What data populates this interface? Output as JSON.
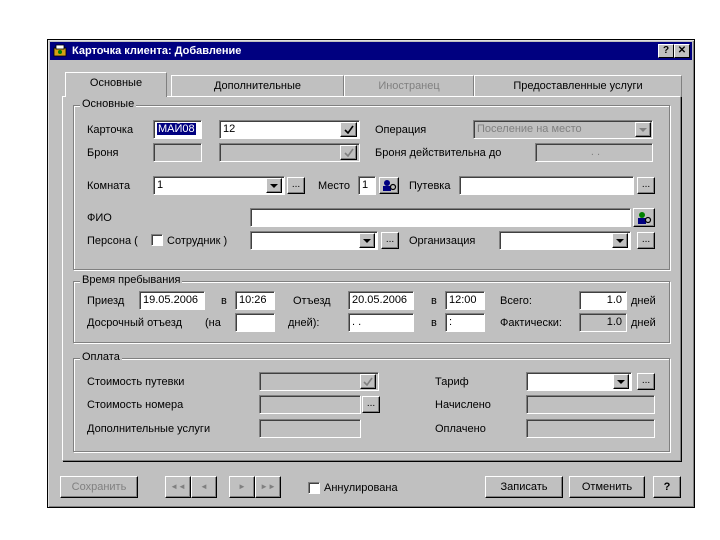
{
  "window": {
    "title": "Карточка клиента: Добавление",
    "help_btn": "?",
    "close_btn": "✕"
  },
  "tabs": [
    {
      "label": "Основные"
    },
    {
      "label": "Дополнительные"
    },
    {
      "label": "Иностранец"
    },
    {
      "label": "Предоставленные услуги"
    }
  ],
  "basic": {
    "legend": "Основные",
    "card_label": "Карточка",
    "card_prefix": "МАЙ08",
    "card_number": "12",
    "operation_label": "Операция",
    "operation_value": "Поселение на место",
    "booking_label": "Броня",
    "booking_valid_label": "Броня действительна до",
    "booking_valid_value": ". .",
    "room_label": "Комната",
    "room_value": "1",
    "place_label": "Место",
    "place_value": "1",
    "voucher_label": "Путевка",
    "voucher_value": "",
    "fio_label": "ФИО",
    "fio_value": "",
    "person_label": "Персона (",
    "employee_label": "Сотрудник )",
    "org_label": "Организация"
  },
  "stay": {
    "legend": "Время пребывания",
    "arrival_label": "Приезд",
    "arrival_date": "19.05.2006",
    "at_label": "в",
    "arrival_time": "10:26",
    "departure_label": "Отъезд",
    "departure_date": "20.05.2006",
    "departure_time": "12:00",
    "total_label": "Всего:",
    "total_value": "1.0",
    "days_label": "дней",
    "early_label": "Досрочный отъезд",
    "na_label": "(на",
    "early_days_value": "",
    "days_paren_label": "дней):",
    "early_date_value": ". .",
    "early_time_value": ":",
    "actual_label": "Фактически:",
    "actual_value": "1.0"
  },
  "payment": {
    "legend": "Оплата",
    "voucher_cost_label": "Стоимость путевки",
    "room_cost_label": "Стоимость номера",
    "extra_label": "Дополнительные услуги",
    "tariff_label": "Тариф",
    "charged_label": "Начислено",
    "paid_label": "Оплачено"
  },
  "footer": {
    "save_label": "Сохранить",
    "first_label": "◄◄",
    "prev_label": "◄",
    "next_label": "►",
    "last_label": "►►",
    "cancelled_label": "Аннулирована",
    "record_label": "Записать",
    "cancel_label": "Отменить",
    "help_label": "?"
  },
  "ellipsis": "...",
  "colors": {
    "titlebar": "#000080",
    "face": "#c0c0c0"
  }
}
